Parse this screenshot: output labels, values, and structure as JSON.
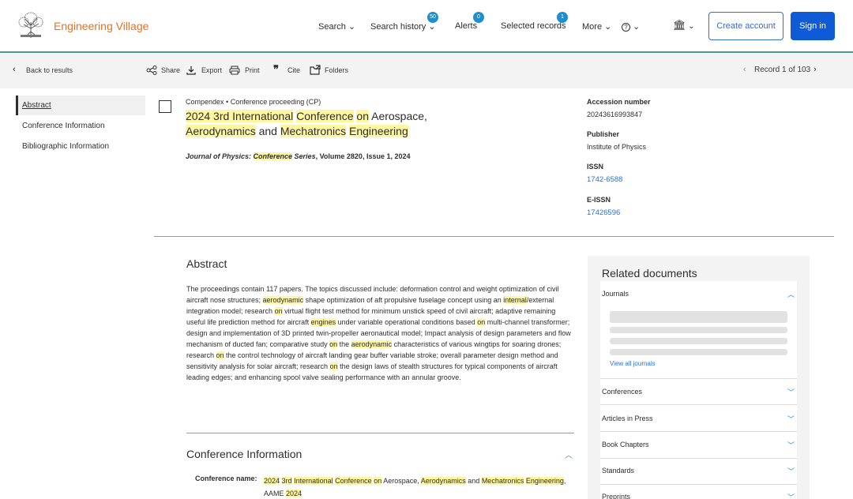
{
  "header": {
    "brand": "Engineering Village",
    "nav": {
      "search": "Search",
      "search_history": "Search history",
      "search_history_count": "50",
      "alerts": "Alerts",
      "alerts_count": "0",
      "selected_records": "Selected records",
      "selected_records_count": "1",
      "more": "More",
      "help": "?"
    },
    "create_account": "Create account",
    "sign_in": "Sign in"
  },
  "toolbar": {
    "back": "Back to results",
    "share": "Share",
    "export": "Export",
    "print": "Print",
    "cite": "Cite",
    "folders": "Folders",
    "record_counter": "Record 1 of 103"
  },
  "left_nav": {
    "items": [
      "Abstract",
      "Conference Information",
      "Bibliographic Information"
    ]
  },
  "record": {
    "database": "Compendex",
    "doc_type": "Conference proceeding (CP)",
    "title_parts": {
      "p1": "2024 3rd ",
      "p2": "International",
      "p3": " ",
      "p4": "Conference",
      "p5": " ",
      "p6": "on",
      "p7": " Aerospace,",
      "p8": "Aerodynamics",
      "p9": " and ",
      "p10": "Mechatronics",
      "p11": " ",
      "p12": "Engineering"
    },
    "journal": {
      "j1": "Journal of Physics: ",
      "j2": "Conference",
      "j3": " Series",
      "j4": ", Volume 2820, Issue 1, 2024"
    }
  },
  "details": {
    "accession_label": "Accession number",
    "accession_value": "20243616993847",
    "publisher_label": "Publisher",
    "publisher_value": "Institute of Physics",
    "issn_label": "ISSN",
    "issn_value": "1742-6588",
    "eissn_label": "E-ISSN",
    "eissn_value": "17426596"
  },
  "abstract": {
    "heading": "Abstract",
    "t1": "The proceedings contain 117 papers. The topics discussed include: deformation control and weight optimization of civil aircraft nose structures; ",
    "h1": "aerodynamic",
    "t2": " shape optimization of aft propulsive fuselage concept using an ",
    "h2": "internal",
    "t3": "/external integration model; research ",
    "h3": "on",
    "t4": " virtual flight test method for minimum unstick speed of civil aircraft; adaptive remaining useful life prediction method for aircraft ",
    "h4": "engines",
    "t5": " under variable operational conditions based ",
    "h5": "on",
    "t6": " multi-channel transformer; design and implementation of 3D printed twin-propeller aeronautical model; Impact analysis of design parameters and flow mechanism of ducted fan; comparative study ",
    "h6": "on",
    "t7": " the ",
    "h7": "aerodynamic",
    "t8": " characteristics of various wingtips for soaring drones; research ",
    "h8": "on",
    "t9": " the control technology of aircraft landing gear buffer variable stroke; overall parameter design method and sensitivity analysis for solar aircraft; research ",
    "h9": "on",
    "t10": " the design laws of stealth structures for typical components of aircraft leading edges; and enhancing spool valve sealing performance with an annular groove."
  },
  "conference": {
    "heading": "Conference Information",
    "name_label": "Conference name:",
    "v1": "2024",
    "v2": " ",
    "v3": "3rd",
    "v4": " ",
    "v5": "International",
    "v6": " ",
    "v7": "Conference",
    "v8": " ",
    "v9": "on",
    "v10": " Aerospace, ",
    "v11": "Aerodynamics",
    "v12": " and ",
    "v13": "Mechatronics",
    "v14": " ",
    "v15": "Engineering",
    "v16": ", AAME ",
    "v17": "2024"
  },
  "related": {
    "heading": "Related documents",
    "journals": "Journals",
    "view_all": "View all journals",
    "items": [
      "Conferences",
      "Articles in Press",
      "Book Chapters",
      "Standards",
      "Preprints"
    ]
  },
  "icons": {
    "chevron_down": "chevron-down-icon",
    "chevron_up": "chevron-up-icon",
    "chevron_left": "chevron-left-icon",
    "chevron_right": "chevron-right-icon",
    "share": "share-icon",
    "export": "download-icon",
    "print": "printer-icon",
    "cite": "quote-icon",
    "folders": "folder-icon",
    "institution": "institution-icon",
    "logo": "elsevier-tree-logo"
  },
  "colors": {
    "brand": "#e9711c",
    "link": "#2f6fd6",
    "badge": "#1d8fce",
    "primary_button": "#0f5bd6",
    "highlight": "#fff6a1",
    "header_border": "#4a9a8c"
  }
}
